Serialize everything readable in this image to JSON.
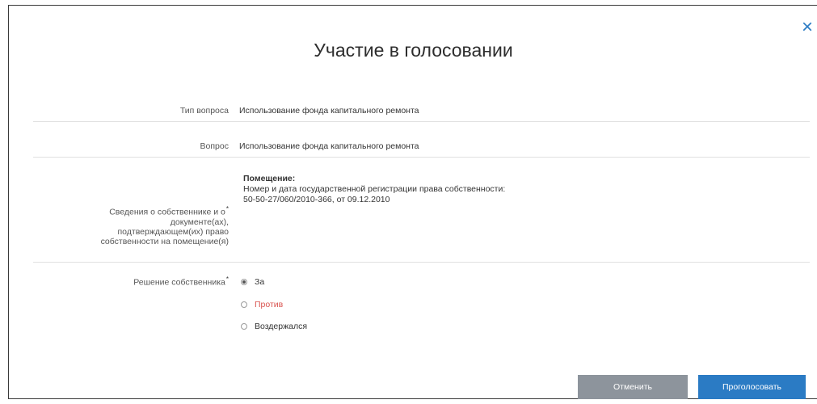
{
  "dialog": {
    "title": "Участие в голосовании",
    "close_symbol": "×"
  },
  "fields": {
    "question_type_label": "Тип вопроса",
    "question_type_value": "Использование фонда капитального ремонта",
    "question_label": "Вопрос",
    "question_value": "Использование фонда капитального ремонта",
    "ownership_label_line1": "Сведения о собственнике и о",
    "ownership_label_line2": "документе(ах),",
    "ownership_label_line3": "подтверждающем(их) право",
    "ownership_label_line4": "собственности на помещение(я)",
    "ownership_value_line1": "Помещение:",
    "ownership_value_line2": "Номер и дата государственной регистрации права собственности:",
    "ownership_value_line3": "50-50-27/060/2010-366, от 09.12.2010",
    "decision_label": "Решение собственника",
    "required_mark": "*"
  },
  "decision_options": [
    {
      "label": "За",
      "checked": true,
      "color": "#333333"
    },
    {
      "label": "Против",
      "checked": false,
      "color": "#d9534f"
    },
    {
      "label": "Воздержался",
      "checked": false,
      "color": "#333333"
    }
  ],
  "buttons": {
    "cancel_label": "Отменить",
    "vote_label": "Проголосовать"
  },
  "colors": {
    "accent": "#2b7bc4",
    "cancel_bg": "#8d949c",
    "against": "#d9534f"
  },
  "icons": {
    "close": "close-icon"
  }
}
